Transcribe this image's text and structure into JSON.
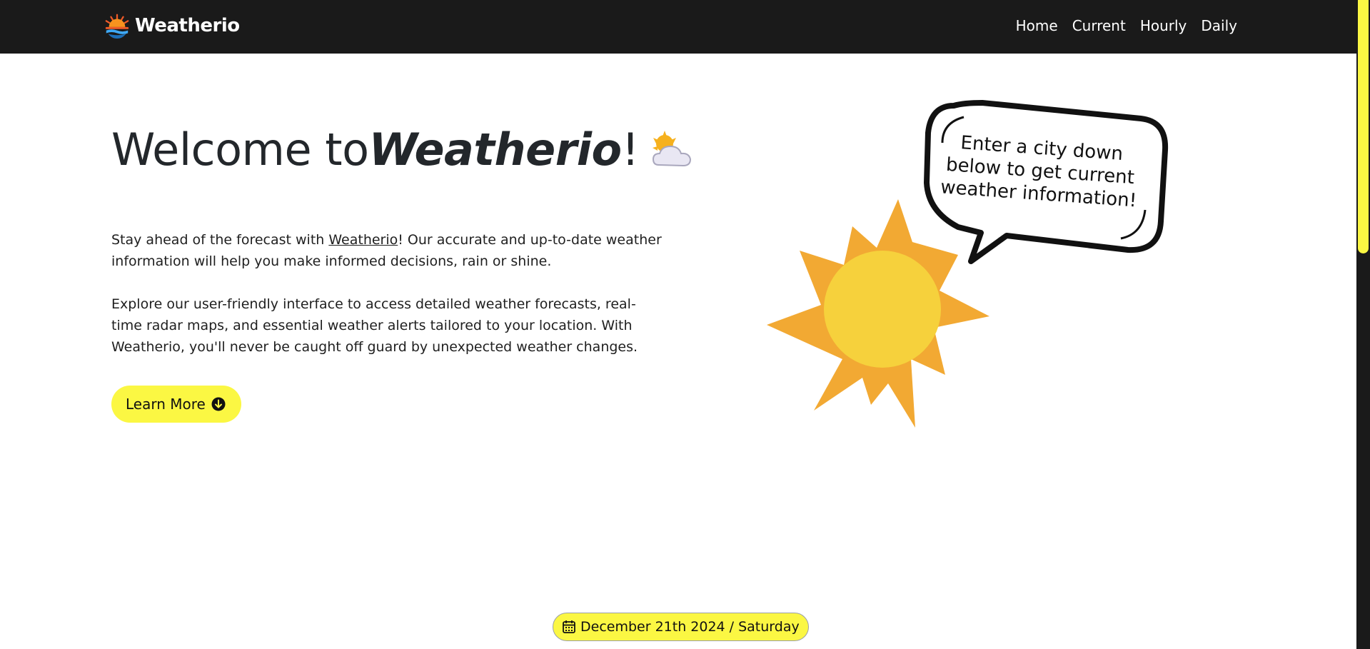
{
  "header": {
    "brand": "Weatherio",
    "nav": [
      {
        "label": "Home"
      },
      {
        "label": "Current"
      },
      {
        "label": "Hourly"
      },
      {
        "label": "Daily"
      }
    ]
  },
  "hero": {
    "title_prefix": "Welcome to ",
    "title_brand": "Weatherio",
    "title_suffix": "!",
    "para1_before": "Stay ahead of the forecast with ",
    "para1_link": "Weatherio",
    "para1_after": "! Our accurate and up-to-date weather information will help you make informed decisions, rain or shine.",
    "para2": "Explore our user-friendly interface to access detailed weather forecasts, real-time radar maps, and essential weather alerts tailored to your location. With Weatherio, you'll never be caught off guard by unexpected weather changes.",
    "cta_label": "Learn More"
  },
  "illustration": {
    "bubble_text": "Enter a city down below to get current weather information!"
  },
  "date_badge": {
    "text": "December 21th 2024 / Saturday"
  },
  "icons": {
    "logo": "sunset-logo-icon",
    "title_icon": "sun-behind-cloud-icon",
    "cta_icon": "arrow-down-circle-icon",
    "date_icon": "calendar-icon"
  },
  "colors": {
    "accent": "#fbf743",
    "navbar": "#1a1a1a",
    "sun_outer": "#f2a933",
    "sun_inner": "#f6d13c"
  }
}
